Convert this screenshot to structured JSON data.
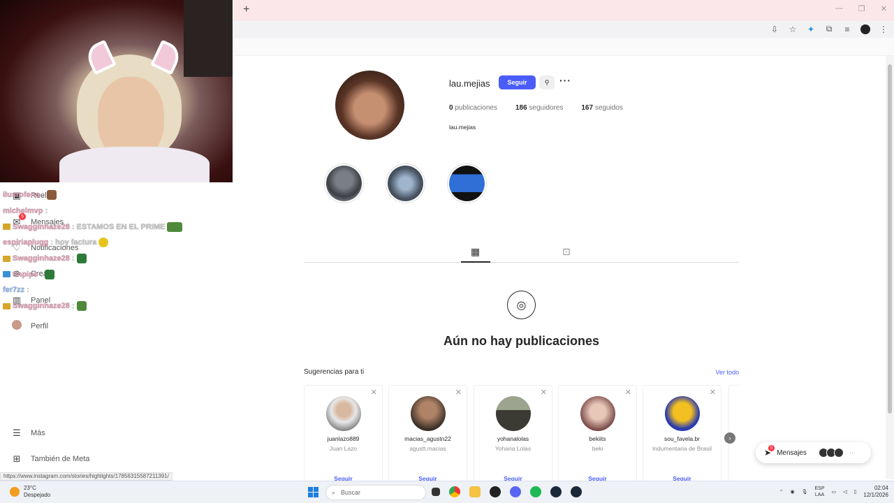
{
  "browser": {
    "new_tab": "+",
    "window_controls": [
      "—",
      "❐",
      "✕"
    ],
    "status_url": "https://www.instagram.com/stories/highlights/17856315587211391/"
  },
  "sidebar": {
    "items": [
      {
        "label": "Reels",
        "icon": "reels-icon",
        "glyph": "▣"
      },
      {
        "label": "Mensajes",
        "icon": "messenger-icon",
        "glyph": "✉"
      },
      {
        "label": "Notificaciones",
        "icon": "heart-icon",
        "glyph": "♡"
      },
      {
        "label": "Crear",
        "icon": "plus-icon",
        "glyph": "⊕"
      },
      {
        "label": "Panel",
        "icon": "dashboard-icon",
        "glyph": "▥"
      },
      {
        "label": "Perfil",
        "icon": "profile-avatar-icon",
        "glyph": ""
      },
      {
        "label": "Más",
        "icon": "menu-icon",
        "glyph": "☰"
      },
      {
        "label": "También de Meta",
        "icon": "grid-icon",
        "glyph": "⊞"
      }
    ],
    "messages_badge": "5"
  },
  "chat": [
    {
      "user": "ilusrofeno",
      "msg": ":"
    },
    {
      "user": "michelmvp",
      "msg": ":"
    },
    {
      "user": "Swagginhaze28",
      "msg": ": ESTAMOS EN EL PRIME"
    },
    {
      "user": "espiriaplugg",
      "msg": ": hoy factura"
    },
    {
      "user": "Swagginhaze28",
      "msg": ":"
    },
    {
      "user": "tinpipo",
      "msg": ":"
    },
    {
      "user": "fer7zz",
      "msg": ":"
    },
    {
      "user": "Swagginhaze28",
      "msg": ":"
    }
  ],
  "profile": {
    "username": "lau.mejias",
    "follow_label": "Seguir",
    "more_label": "···",
    "posts_count": "0",
    "posts_label": "publicaciones",
    "followers_count": "186",
    "followers_label": "seguidores",
    "following_count": "167",
    "following_label": "seguidos",
    "display_name": "lau.mejias"
  },
  "empty": {
    "title": "Aún no hay publicaciones"
  },
  "suggestions": {
    "heading": "Sugerencias para ti",
    "see_all": "Ver todo",
    "follow_label": "Seguir",
    "cards": [
      {
        "username": "juanlazo889",
        "name": "Juan Lazo"
      },
      {
        "username": "macias_agustn22",
        "name": "agustt.macias"
      },
      {
        "username": "yohanalolas",
        "name": "Yohana Lolas"
      },
      {
        "username": "bekiits",
        "name": "beki"
      },
      {
        "username": "sou_favela.br",
        "name": "Indumentaria de Brasil"
      }
    ]
  },
  "messages_pill": {
    "label": "Mensajes",
    "count": "5"
  },
  "taskbar": {
    "temp": "23°C",
    "weather": "Despejado",
    "search_placeholder": "Buscar",
    "lang": "ESP",
    "region": "LAA",
    "time": "02:04",
    "date": "12/1/2026"
  }
}
